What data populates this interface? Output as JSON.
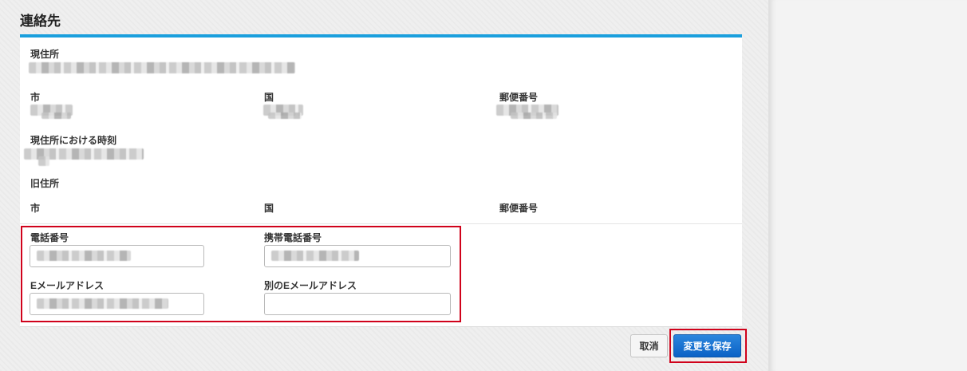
{
  "section": {
    "title": "連絡先"
  },
  "address": {
    "current_label": "現住所",
    "city_label": "市",
    "country_label": "国",
    "zip_label": "郵便番号",
    "time_label": "現住所における時刻",
    "previous_label": "旧住所",
    "prev_city_label": "市",
    "prev_country_label": "国",
    "prev_zip_label": "郵便番号"
  },
  "contact": {
    "phone_label": "電話番号",
    "mobile_label": "携帯電話番号",
    "email_label": "Eメールアドレス",
    "alt_email_label": "別のEメールアドレス",
    "alt_email_value": ""
  },
  "actions": {
    "cancel_label": "取消",
    "save_label": "変更を保存"
  },
  "colors": {
    "accent_bar": "#1a9fdd",
    "highlight": "#d0021b",
    "save_button": "#0b62c6"
  }
}
